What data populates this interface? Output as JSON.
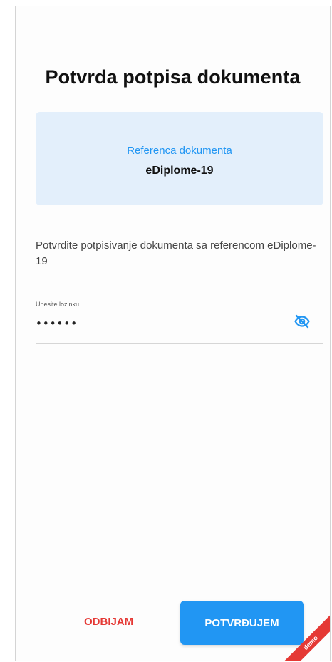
{
  "page": {
    "title": "Potvrda potpisa dokumenta"
  },
  "reference_card": {
    "label": "Referenca dokumenta",
    "value": "eDiplome-19"
  },
  "description": "Potvrdite potpisivanje dokumenta sa referencom eDiplome-19",
  "password": {
    "label": "Unesite lozinku",
    "value": "••••••",
    "toggle_icon": "eye-off-icon"
  },
  "actions": {
    "reject_label": "ODBIJAM",
    "confirm_label": "POTVRĐUJEM"
  },
  "ribbon": {
    "label": "demo"
  },
  "colors": {
    "accent": "#2196f3",
    "danger": "#e53935",
    "card_bg": "#e3effb"
  }
}
